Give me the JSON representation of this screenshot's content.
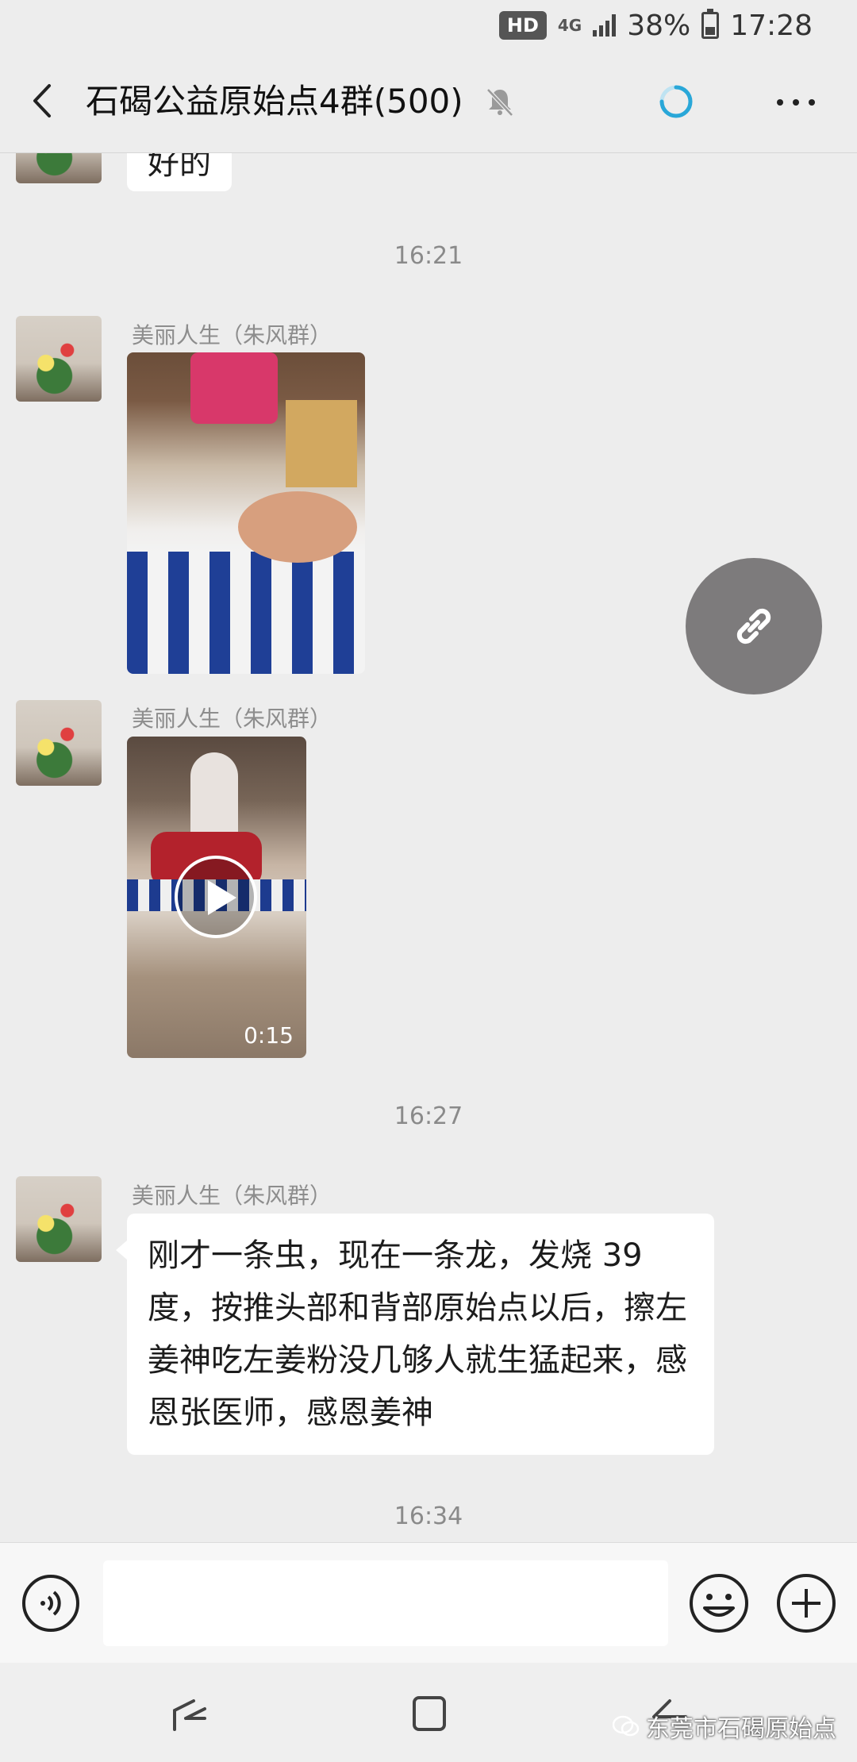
{
  "status_bar": {
    "hd": "HD",
    "network": "4G",
    "battery": "38%",
    "time": "17:28"
  },
  "header": {
    "title": "石碣公益原始点4群(500)"
  },
  "messages": {
    "m0_text": "好的",
    "t1": "16:21",
    "m1_sender": "美丽人生（朱风群）",
    "m2_sender": "美丽人生（朱风群）",
    "m2_duration": "0:15",
    "t2": "16:27",
    "m3_sender": "美丽人生（朱风群）",
    "m3_text": "刚才一条虫，现在一条龙，发烧 39 度，按推头部和背部原始点以后，擦左姜神吃左姜粉没几够人就生猛起来，感恩张医师，感恩姜神",
    "t3": "16:34"
  },
  "input": {
    "placeholder": ""
  },
  "watermark": "东莞市石碣原始点",
  "icons": {
    "back": "back-arrow-icon",
    "mute": "mute-bell-icon",
    "loading": "loading-spinner-icon",
    "more": "more-dots-icon",
    "link": "link-icon",
    "voice": "voice-icon",
    "emoji": "emoji-icon",
    "plus": "plus-icon"
  },
  "colors": {
    "background": "#ededed",
    "bubble": "#ffffff",
    "accent_spinner": "#29a7d8",
    "link_fab": "#7d7b7c"
  }
}
